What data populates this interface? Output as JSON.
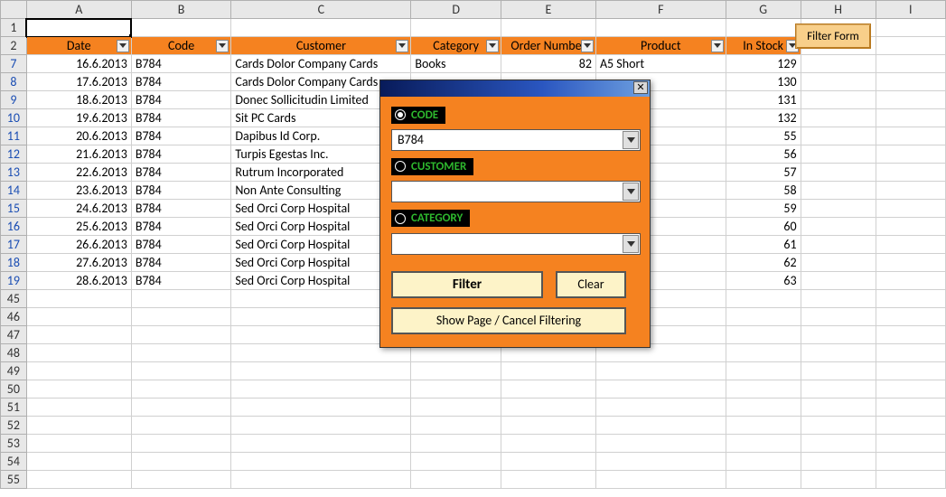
{
  "columns": {
    "letters": [
      "A",
      "B",
      "C",
      "D",
      "E",
      "F",
      "G",
      "H",
      "I"
    ],
    "widths": [
      105,
      100,
      180,
      90,
      95,
      130,
      75,
      75,
      70
    ]
  },
  "header_row_number": "2",
  "headers": [
    "Date",
    "Code",
    "Customer",
    "Category",
    "Order Number",
    "Product",
    "In Stock"
  ],
  "pre_rows": [
    "1"
  ],
  "data_row_numbers": [
    "7",
    "8",
    "9",
    "10",
    "11",
    "12",
    "13",
    "14",
    "15",
    "16",
    "17",
    "18",
    "19"
  ],
  "post_rows": [
    "45",
    "46",
    "47",
    "48",
    "49",
    "50",
    "51",
    "52",
    "53",
    "54",
    "55"
  ],
  "rows": [
    {
      "date": "16.6.2013",
      "code": "B784",
      "customer": "Cards Dolor Company Cards",
      "category": "Books",
      "order": "82",
      "product": "A5 Short",
      "stock": "129"
    },
    {
      "date": "17.6.2013",
      "code": "B784",
      "customer": "Cards Dolor Company Cards",
      "category": "",
      "order": "",
      "product": "",
      "stock": "130"
    },
    {
      "date": "18.6.2013",
      "code": "B784",
      "customer": "Donec Sollicitudin Limited",
      "category": "",
      "order": "",
      "product": "",
      "stock": "131"
    },
    {
      "date": "19.6.2013",
      "code": "B784",
      "customer": "Sit PC Cards",
      "category": "",
      "order": "",
      "product": "",
      "stock": "132"
    },
    {
      "date": "20.6.2013",
      "code": "B784",
      "customer": "Dapibus Id Corp.",
      "category": "",
      "order": "",
      "product": "",
      "stock": "55"
    },
    {
      "date": "21.6.2013",
      "code": "B784",
      "customer": "Turpis Egestas Inc.",
      "category": "",
      "order": "",
      "product": "",
      "stock": "56"
    },
    {
      "date": "22.6.2013",
      "code": "B784",
      "customer": "Rutrum Incorporated",
      "category": "",
      "order": "",
      "product": "",
      "stock": "57"
    },
    {
      "date": "23.6.2013",
      "code": "B784",
      "customer": "Non Ante Consulting",
      "category": "",
      "order": "",
      "product": "",
      "stock": "58"
    },
    {
      "date": "24.6.2013",
      "code": "B784",
      "customer": "Sed Orci Corp Hospital",
      "category": "",
      "order": "",
      "product": "",
      "stock": "59"
    },
    {
      "date": "25.6.2013",
      "code": "B784",
      "customer": "Sed Orci Corp Hospital",
      "category": "",
      "order": "",
      "product": "",
      "stock": "60"
    },
    {
      "date": "26.6.2013",
      "code": "B784",
      "customer": "Sed Orci Corp Hospital",
      "category": "",
      "order": "",
      "product": "",
      "stock": "61"
    },
    {
      "date": "27.6.2013",
      "code": "B784",
      "customer": "Sed Orci Corp Hospital",
      "category": "",
      "order": "",
      "product": "",
      "stock": "62"
    },
    {
      "date": "28.6.2013",
      "code": "B784",
      "customer": "Sed Orci Corp Hospital",
      "category": "",
      "order": "",
      "product": "",
      "stock": "63"
    }
  ],
  "filter_form_button_label": "Filter Form",
  "userform": {
    "close_glyph": "✕",
    "fields": {
      "code": {
        "label": "CODE",
        "value": "B784",
        "selected": true
      },
      "customer": {
        "label": "CUSTOMER",
        "value": "",
        "selected": false
      },
      "category": {
        "label": "CATEGORY",
        "value": "",
        "selected": false
      }
    },
    "buttons": {
      "filter": "Filter",
      "clear": "Clear",
      "show_page": "Show Page / Cancel Filtering"
    }
  }
}
